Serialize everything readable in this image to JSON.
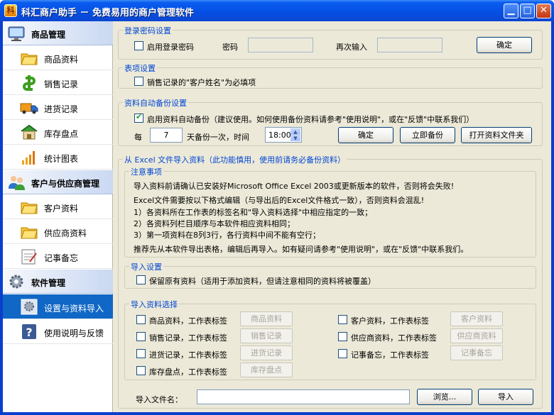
{
  "window": {
    "title": "科汇商户助手 － 免费易用的商户管理软件",
    "controls": {
      "minimize": "▁",
      "maximize": "□",
      "close": "✕"
    }
  },
  "sidebar": {
    "sections": [
      {
        "label": "商品管理",
        "icon": "monitor-icon",
        "items": [
          {
            "label": "商品资料",
            "icon": "folder-icon"
          },
          {
            "label": "销售记录",
            "icon": "money-icon"
          },
          {
            "label": "进货记录",
            "icon": "truck-icon"
          },
          {
            "label": "库存盘点",
            "icon": "warehouse-icon"
          },
          {
            "label": "统计图表",
            "icon": "bar-chart-icon"
          }
        ]
      },
      {
        "label": "客户与供应商管理",
        "icon": "people-icon",
        "items": [
          {
            "label": "客户资料",
            "icon": "folder-icon"
          },
          {
            "label": "供应商资料",
            "icon": "folder-icon"
          },
          {
            "label": "记事备忘",
            "icon": "notepad-icon"
          }
        ]
      },
      {
        "label": "软件管理",
        "icon": "gear-icon",
        "items": [
          {
            "label": "设置与资料导入",
            "icon": "settings-icon",
            "active": true
          },
          {
            "label": "使用说明与反馈",
            "icon": "help-icon"
          }
        ]
      }
    ]
  },
  "login": {
    "title": "登录密码设置",
    "enable_label": "启用登录密码",
    "enabled": false,
    "password_label": "密码",
    "confirm_label": "再次输入",
    "ok": "确定"
  },
  "form": {
    "title": "表项设置",
    "require_customer_label": "销售记录的\"客户姓名\"为必填项",
    "checked": false
  },
  "backup": {
    "title": "资料自动备份设置",
    "enable_label": "启用资料自动备份（建议使用。如何使用备份资料请参考\"使用说明\"，或在\"反馈\"中联系我们）",
    "enabled": true,
    "every_label": "每",
    "days": "7",
    "days_suffix": "天备份一次，时间",
    "time": "18:00",
    "ok": "确定",
    "backup_now": "立即备份",
    "open_folder": "打开资料文件夹"
  },
  "import": {
    "title": "从 Excel 文件导入资料（此功能慎用，使用前请务必备份资料）",
    "notes": {
      "title": "注意事项",
      "lines": [
        "导入资料前请确认已安装好Microsoft Office Excel 2003或更新版本的软件，否则将会失败!",
        "Excel文件需要按以下格式编辑（与导出后的Excel文件格式一致），否则资料会混乱!",
        "1）各资料所在工作表的标签名和\"导入资料选择\"中相应指定的一致；",
        "2）各资料列栏目顺序与本软件相应资料相同；",
        "3）第一项资料在8列3行，各行资料中间不能有空行；",
        "推荐先从本软件导出表格，编辑后再导入。如有疑问请参考\"使用说明\"，或在\"反馈\"中联系我们。"
      ]
    },
    "settings": {
      "title": "导入设置",
      "keep_label": "保留原有资料（适用于添加资料，但请注意相同的资料将被覆盖）",
      "checked": false
    },
    "selection": {
      "title": "导入资料选择",
      "items": [
        {
          "label": "商品资料，工作表标签",
          "sheet": "商品资料",
          "checked": false
        },
        {
          "label": "销售记录，工作表标签",
          "sheet": "销售记录",
          "checked": false
        },
        {
          "label": "进货记录，工作表标签",
          "sheet": "进货记录",
          "checked": false
        },
        {
          "label": "库存盘点，工作表标签",
          "sheet": "库存盘点",
          "checked": false
        },
        {
          "label": "客户资料，工作表标签",
          "sheet": "客户资料",
          "checked": false
        },
        {
          "label": "供应商资料，工作表标签",
          "sheet": "供应商资料",
          "checked": false
        },
        {
          "label": "记事备忘，工作表标签",
          "sheet": "记事备忘",
          "checked": false
        }
      ]
    },
    "file_label": "导入文件名：",
    "file_value": "",
    "browse": "浏览...",
    "import_btn": "导入"
  },
  "colors": {
    "group_title": "#0046d5",
    "active_nav": "#1067c5",
    "title_bar": "#0550e4"
  }
}
